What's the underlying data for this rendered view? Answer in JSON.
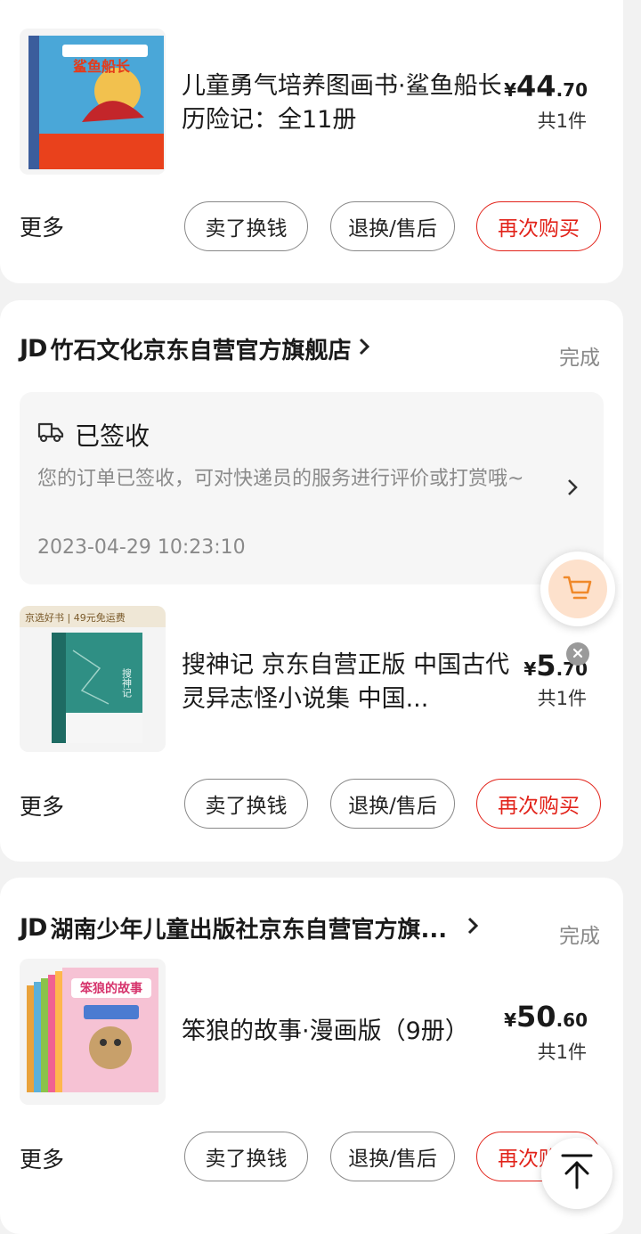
{
  "orders": [
    {
      "title": "儿童勇气培养图画书·鲨鱼船长历险记：全11册",
      "price_symbol": "¥",
      "price_int": "44",
      "price_dec": ".70",
      "qty": "共1件",
      "more": "更多",
      "btn_sell": "卖了换钱",
      "btn_return": "退换/售后",
      "btn_rebuy": "再次购买",
      "cover_text": "鲨鱼船长"
    },
    {
      "shop_logo": "JD",
      "shop_name": "竹石文化京东自营官方旗舰店",
      "shop_arrow": "›",
      "status": "完成",
      "logistics_title": "已签收",
      "logistics_desc": "您的订单已签收，可对快递员的服务进行评价或打赏哦~",
      "logistics_time": "2023-04-29 10:23:10",
      "title": "搜神记 京东自营正版 中国古代灵异志怪小说集 中国...",
      "price_symbol": "¥",
      "price_int": "5",
      "price_dec": ".70",
      "qty": "共1件",
      "more": "更多",
      "btn_sell": "卖了换钱",
      "btn_return": "退换/售后",
      "btn_rebuy": "再次购买",
      "cover_badge": "京选好书 | 49元免运费",
      "cover_text": "搜神记"
    },
    {
      "shop_logo": "JD",
      "shop_name": "湖南少年儿童出版社京东自营官方旗...",
      "shop_arrow": "›",
      "status": "完成",
      "title": "笨狼的故事·漫画版（9册）",
      "price_symbol": "¥",
      "price_int": "50",
      "price_dec": ".60",
      "qty": "共1件",
      "more": "更多",
      "btn_sell": "卖了换钱",
      "btn_return": "退换/售后",
      "btn_rebuy": "再次购买",
      "cover_text": "笨狼的故事"
    }
  ],
  "floating": {
    "cart_icon": "cart-icon",
    "close_icon": "close-icon",
    "top_icon": "back-to-top-icon"
  },
  "colors": {
    "accent": "#e2231a",
    "cart_bg": "#fde1cc",
    "cart_stroke": "#f0892a"
  }
}
